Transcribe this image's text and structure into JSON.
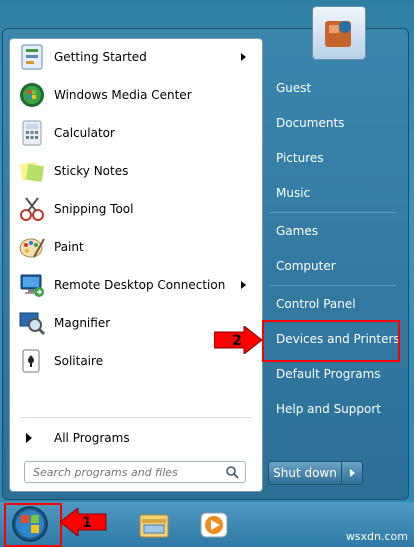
{
  "left_programs": [
    {
      "label": "Getting Started",
      "icon": "getting-started-icon",
      "submenu": true
    },
    {
      "label": "Windows Media Center",
      "icon": "media-center-icon",
      "submenu": false
    },
    {
      "label": "Calculator",
      "icon": "calculator-icon",
      "submenu": false
    },
    {
      "label": "Sticky Notes",
      "icon": "sticky-notes-icon",
      "submenu": false
    },
    {
      "label": "Snipping Tool",
      "icon": "snipping-tool-icon",
      "submenu": false
    },
    {
      "label": "Paint",
      "icon": "paint-icon",
      "submenu": false
    },
    {
      "label": "Remote Desktop Connection",
      "icon": "remote-desktop-icon",
      "submenu": true
    },
    {
      "label": "Magnifier",
      "icon": "magnifier-icon",
      "submenu": false
    },
    {
      "label": "Solitaire",
      "icon": "solitaire-icon",
      "submenu": false
    }
  ],
  "all_programs_label": "All Programs",
  "search": {
    "placeholder": "Search programs and files"
  },
  "right_items": [
    {
      "label": "Guest"
    },
    {
      "label": "Documents"
    },
    {
      "label": "Pictures"
    },
    {
      "label": "Music"
    },
    {
      "label": "Games"
    },
    {
      "label": "Computer"
    },
    {
      "label": "Control Panel"
    },
    {
      "label": "Devices and Printers"
    },
    {
      "label": "Default Programs"
    },
    {
      "label": "Help and Support"
    }
  ],
  "shutdown_label": "Shut down",
  "callouts": [
    {
      "number": "1",
      "color": "#ff0000"
    },
    {
      "number": "2",
      "color": "#ff0000"
    }
  ],
  "watermark": "wsxdn.com"
}
